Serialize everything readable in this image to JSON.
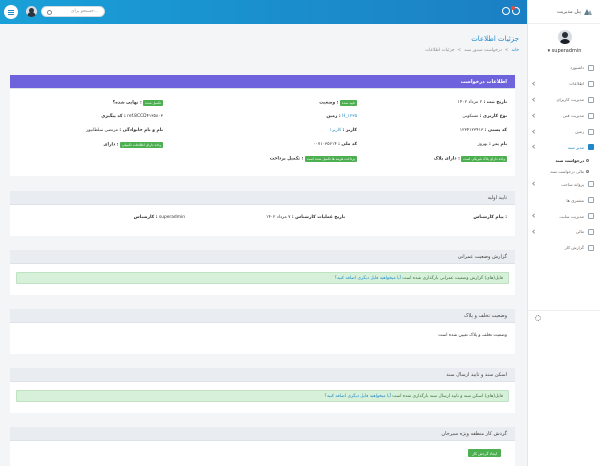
{
  "topbar": {
    "search_placeholder": "جستجو برای...",
    "menu_icon": "menu-icon",
    "notification_icon": "bell-icon"
  },
  "sidebar": {
    "brand": "پنل مدیریت",
    "user_name": "superadmin",
    "items": [
      {
        "label": "داشبورد",
        "icon": "dashboard-icon"
      },
      {
        "label": "اطلاعات",
        "icon": "info-icon"
      },
      {
        "label": "مدیریت کاربران",
        "icon": "users-icon"
      },
      {
        "label": "مدیریت فنی",
        "icon": "tools-icon"
      },
      {
        "label": "زمین",
        "icon": "map-icon"
      },
      {
        "label": "مدیر سند",
        "icon": "document-icon"
      }
    ],
    "sub_items": [
      {
        "label": "درخواست سند"
      },
      {
        "label": "مالی درخواست سند"
      }
    ],
    "items2": [
      {
        "label": "پروانه ساخت",
        "icon": "permit-icon"
      },
      {
        "label": "مشتری ها",
        "icon": "customers-icon"
      },
      {
        "label": "مدیریت سایت",
        "icon": "site-icon"
      },
      {
        "label": "مالی",
        "icon": "money-icon"
      },
      {
        "label": "گزارش کار",
        "icon": "report-icon"
      }
    ],
    "settings_icon": "gear-icon"
  },
  "header": {
    "title": "جزئیات اطلاعات",
    "breadcrumb": [
      "خانه",
      "درخواست صدور سند",
      "جزئیات اطلاعات"
    ]
  },
  "request": {
    "title": "اطلاعات درخواست",
    "register_date_label": "تاریخ ثبت :",
    "register_date": "۲ مرداد ۱۴۰۲",
    "status_label": "وضعیت :",
    "status_badge": "تایید شده",
    "final_label": "نهایی شده؟ :",
    "final_badge": "تکمیل شده",
    "type_label": "نوع کاربری :",
    "type_value": "مسکونی",
    "land_label": "زمین :",
    "land_value": "H_۱۲۳۵",
    "tracking_label": "کد پیگیری :",
    "tracking_value": "ref.8CCD۴۱۳۵۸۰۳",
    "postal_label": "کد پستی :",
    "postal_value": "۱۲۳۴۱۲۳۴۱۳",
    "owner_label": "کاربر :",
    "owner_value": "کاربر۱",
    "fullname_label": "نام و نام خانوادگی :",
    "fullname_value": "مرتضی سلطانپور",
    "father_label": "نام پدر :",
    "father_value": "بهروز",
    "national_label": "کد ملی :",
    "national_value": "۰۰۷۱۰۳۵۶۱۴",
    "owns_label": "دارای :",
    "owns_badge": "واحد دارای اطلاعات تکمیلی",
    "plaque_label": "دارای پلاک :",
    "plaque_badge": "واحد دارای پلاک فیزیکی است",
    "payment_label": "تکمیل پرداخت :",
    "payment_badge": "پرداخت هزینه ها تکمیل شده است"
  },
  "approval": {
    "title": "تایید اولیه",
    "message_label": "پیام کارشناس :",
    "date_label": "تاریخ عملیات کارشناس :",
    "date_value": "۷ مرداد ۱۴۰۲",
    "expert_label": "کارشناس :",
    "expert_value": "superadmin"
  },
  "construction": {
    "title": "گزارش وضعیت عمرانی",
    "text": "فایل(های) گزارش وضعیت عمرانی بارگذاری شده است",
    "link": "آیا میخواهید فایل دیگری اضافه کنید؟"
  },
  "violation": {
    "title": "وضعیت تخلف و پلاک",
    "text": "وضعیت تخلف و پلاک تعیین شده است"
  },
  "scan": {
    "title": "اسکن سند و تایید ارسال سند",
    "text": "فایل(های) اسکن سند و تایید ارسال سند بارگذاری شده است",
    "link": "آیا میخواهید فایل دیگری اضافه کنید؟"
  },
  "zone": {
    "title": "گردش کار منطقه ویژه سیرجان",
    "button": "ایجاد گردش کار"
  }
}
